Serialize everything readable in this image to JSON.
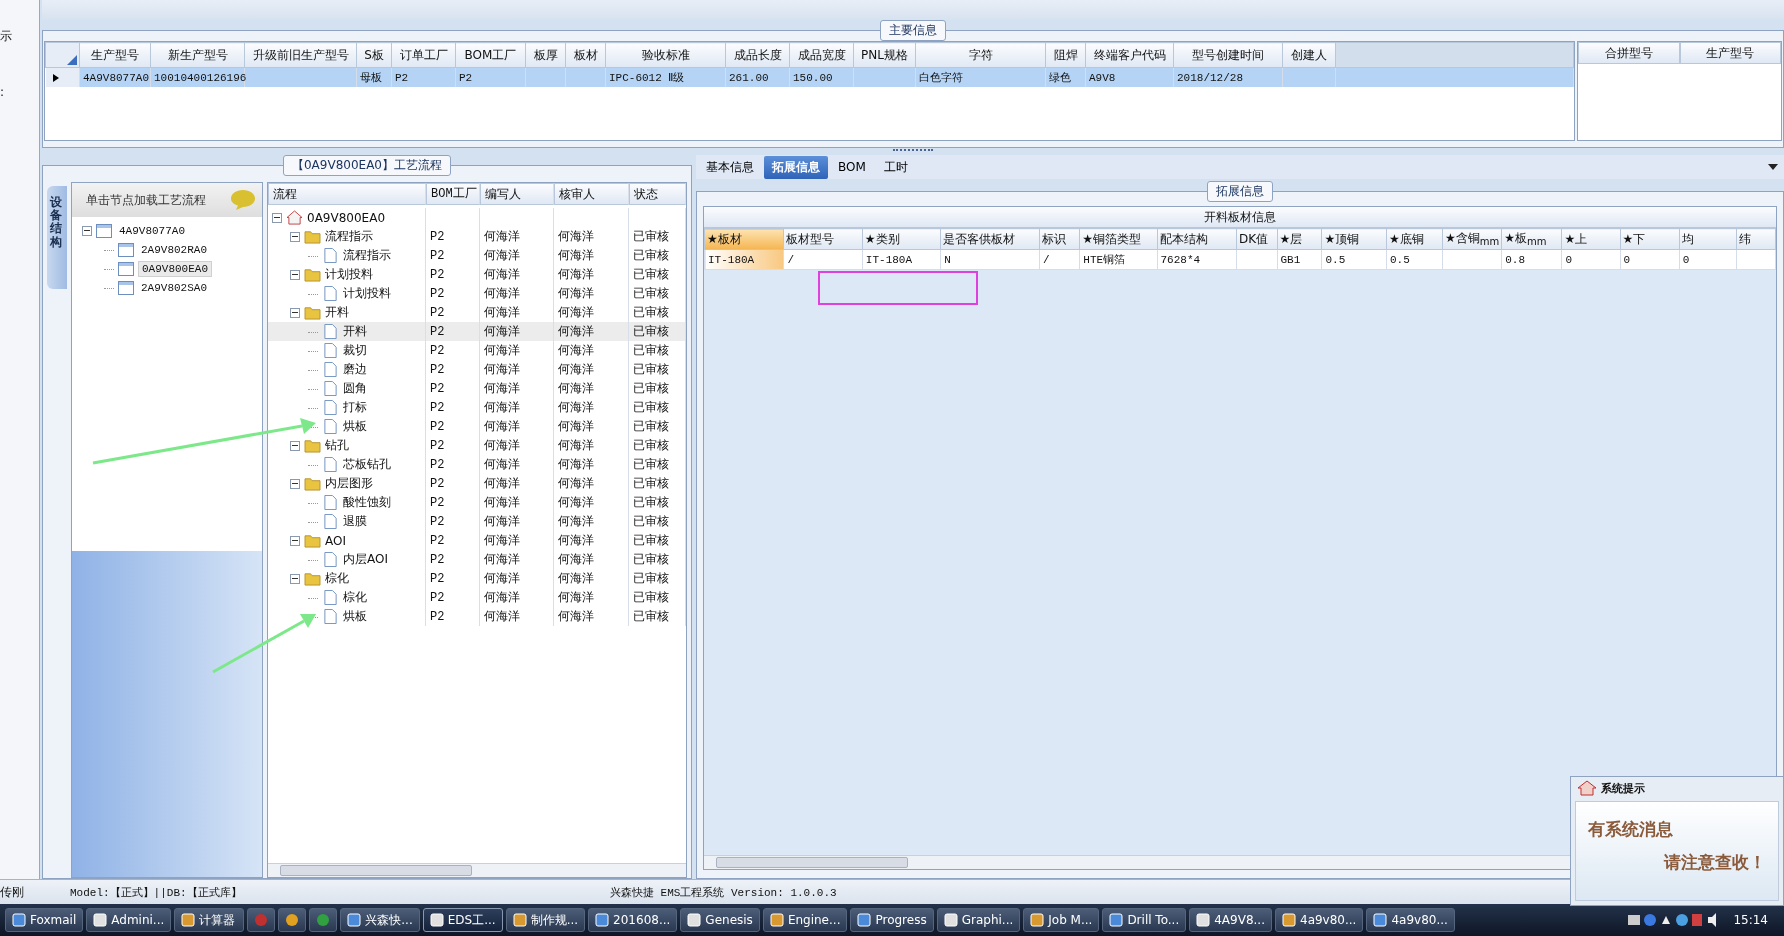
{
  "left_edge": {
    "texts": [
      "示",
      ":"
    ]
  },
  "main_info": {
    "title": "主要信息",
    "columns": [
      "生产型号",
      "新生产型号",
      "升级前旧生产型号",
      "S板",
      "订单工厂",
      "BOM工厂",
      "板厚",
      "板材",
      "验收标准",
      "成品长度",
      "成品宽度",
      "PNL规格",
      "字符",
      "阻焊",
      "终端客户代码",
      "型号创建时间",
      "创建人"
    ],
    "rows": [
      {
        "selected": true,
        "cells": [
          "4A9V8077A0",
          "10010400126196",
          null,
          "母板",
          "P2",
          "P2",
          null,
          null,
          "IPC-6012 Ⅱ级",
          "261.00",
          "150.00",
          null,
          "白色字符",
          "绿色",
          "A9V8",
          "2018/12/28",
          null
        ]
      }
    ],
    "side_columns": [
      "合拼型号",
      "生产型号"
    ]
  },
  "process": {
    "title": "【0A9V800EA0】工艺流程",
    "side_tab": "设备结构",
    "hint": "单击节点加载工艺流程",
    "model_tree": [
      {
        "label": "4A9V8077A0",
        "expanded": true,
        "selected": false,
        "children": [
          {
            "label": "2A9V802RA0",
            "selected": false
          },
          {
            "label": "0A9V800EA0",
            "selected": true
          },
          {
            "label": "2A9V802SA0",
            "selected": false
          }
        ]
      }
    ],
    "columns": [
      "流程",
      "BOM工厂",
      "编写人",
      "核审人",
      "状态"
    ],
    "tree": [
      {
        "label": "0A9V800EA0",
        "kind": "root",
        "expanded": true,
        "selected": false,
        "children": [
          {
            "label": "流程指示",
            "kind": "folder",
            "expanded": true,
            "selected": false,
            "bom": "P2",
            "writer": "何海洋",
            "reviewer": "何海洋",
            "status": "已审核",
            "children": [
              {
                "label": "流程指示",
                "kind": "step",
                "selected": false,
                "bom": "P2",
                "writer": "何海洋",
                "reviewer": "何海洋",
                "status": "已审核"
              }
            ]
          },
          {
            "label": "计划投料",
            "kind": "folder",
            "expanded": true,
            "selected": false,
            "bom": "P2",
            "writer": "何海洋",
            "reviewer": "何海洋",
            "status": "已审核",
            "children": [
              {
                "label": "计划投料",
                "kind": "step",
                "selected": false,
                "bom": "P2",
                "writer": "何海洋",
                "reviewer": "何海洋",
                "status": "已审核"
              }
            ]
          },
          {
            "label": "开料",
            "kind": "folder",
            "expanded": true,
            "selected": false,
            "bom": "P2",
            "writer": "何海洋",
            "reviewer": "何海洋",
            "status": "已审核",
            "children": [
              {
                "label": "开料",
                "kind": "step",
                "selected": true,
                "bom": "P2",
                "writer": "何海洋",
                "reviewer": "何海洋",
                "status": "已审核"
              },
              {
                "label": "裁切",
                "kind": "step",
                "selected": false,
                "bom": "P2",
                "writer": "何海洋",
                "reviewer": "何海洋",
                "status": "已审核"
              },
              {
                "label": "磨边",
                "kind": "step",
                "selected": false,
                "bom": "P2",
                "writer": "何海洋",
                "reviewer": "何海洋",
                "status": "已审核"
              },
              {
                "label": "圆角",
                "kind": "step",
                "selected": false,
                "bom": "P2",
                "writer": "何海洋",
                "reviewer": "何海洋",
                "status": "已审核"
              },
              {
                "label": "打标",
                "kind": "step",
                "selected": false,
                "bom": "P2",
                "writer": "何海洋",
                "reviewer": "何海洋",
                "status": "已审核"
              },
              {
                "label": "烘板",
                "kind": "step",
                "selected": false,
                "bom": "P2",
                "writer": "何海洋",
                "reviewer": "何海洋",
                "status": "已审核"
              }
            ]
          },
          {
            "label": "钻孔",
            "kind": "folder",
            "expanded": true,
            "selected": false,
            "bom": "P2",
            "writer": "何海洋",
            "reviewer": "何海洋",
            "status": "已审核",
            "children": [
              {
                "label": "芯板钻孔",
                "kind": "step",
                "selected": false,
                "bom": "P2",
                "writer": "何海洋",
                "reviewer": "何海洋",
                "status": "已审核"
              }
            ]
          },
          {
            "label": "内层图形",
            "kind": "folder",
            "expanded": true,
            "selected": false,
            "bom": "P2",
            "writer": "何海洋",
            "reviewer": "何海洋",
            "status": "已审核",
            "children": [
              {
                "label": "酸性蚀刻",
                "kind": "step",
                "selected": false,
                "bom": "P2",
                "writer": "何海洋",
                "reviewer": "何海洋",
                "status": "已审核"
              },
              {
                "label": "退膜",
                "kind": "step",
                "selected": false,
                "bom": "P2",
                "writer": "何海洋",
                "reviewer": "何海洋",
                "status": "已审核"
              }
            ]
          },
          {
            "label": "AOI",
            "kind": "folder",
            "expanded": true,
            "selected": false,
            "bom": "P2",
            "writer": "何海洋",
            "reviewer": "何海洋",
            "status": "已审核",
            "children": [
              {
                "label": "内层AOI",
                "kind": "step",
                "selected": false,
                "bom": "P2",
                "writer": "何海洋",
                "reviewer": "何海洋",
                "status": "已审核"
              }
            ]
          },
          {
            "label": "棕化",
            "kind": "folder",
            "expanded": true,
            "selected": false,
            "bom": "P2",
            "writer": "何海洋",
            "reviewer": "何海洋",
            "status": "已审核",
            "children": [
              {
                "label": "棕化",
                "kind": "step",
                "selected": false,
                "bom": "P2",
                "writer": "何海洋",
                "reviewer": "何海洋",
                "status": "已审核"
              },
              {
                "label": "烘板",
                "kind": "step",
                "selected": false,
                "bom": "P2",
                "writer": "何海洋",
                "reviewer": "何海洋",
                "status": "已审核"
              }
            ]
          }
        ]
      }
    ]
  },
  "detail": {
    "tabs": [
      {
        "label": "基本信息",
        "selected": false
      },
      {
        "label": "拓展信息",
        "selected": true
      },
      {
        "label": "BOM",
        "selected": false
      },
      {
        "label": "工时",
        "selected": false
      }
    ],
    "group_title": "拓展信息",
    "table_title": "开料板材信息",
    "columns": [
      {
        "label": "★板材",
        "selected": true
      },
      {
        "label": "板材型号",
        "selected": false
      },
      {
        "label": "★类别",
        "selected": false
      },
      {
        "label": "是否客供板材",
        "selected": false
      },
      {
        "label": "标识",
        "selected": false
      },
      {
        "label": "★铜箔类型",
        "selected": false
      },
      {
        "label": "配本结构",
        "selected": false
      },
      {
        "label": "DK值",
        "selected": false
      },
      {
        "label": "★层",
        "selected": false
      },
      {
        "label": "★顶铜",
        "selected": false
      },
      {
        "label": "★底铜",
        "selected": false
      },
      {
        "label": "★含铜$_{mm}$",
        "selected": false
      },
      {
        "label": "★板$_{mm}$",
        "selected": false
      },
      {
        "label": "★上",
        "selected": false
      },
      {
        "label": "★下",
        "selected": false
      },
      {
        "label": "均",
        "selected": false
      },
      {
        "label": "纬",
        "selected": false
      }
    ],
    "rows": [
      {
        "cells": [
          "IT-180A",
          "/",
          "IT-180A",
          "N",
          "/",
          "HTE铜箔",
          "7628*4",
          null,
          "GB1",
          "0.5",
          "0.5",
          null,
          "0.8",
          "0",
          "0",
          "0",
          null
        ]
      }
    ]
  },
  "status_bar": {
    "user": "传刚",
    "model": "Model:【正式】||DB:【正式库】",
    "app": "兴森快捷 EMS工程系统 Version: 1.0.0.3"
  },
  "popup": {
    "title": "系统提示",
    "lines": [
      "有系统消息",
      "请注意查收！"
    ]
  },
  "taskbar": {
    "items": [
      {
        "kind": "app",
        "label": "Foxmail",
        "selected": false
      },
      {
        "kind": "app",
        "label": "Admini...",
        "selected": false
      },
      {
        "kind": "app",
        "label": "计算器",
        "selected": false
      },
      {
        "kind": "icon",
        "selected": false
      },
      {
        "kind": "icon",
        "selected": false
      },
      {
        "kind": "icon",
        "selected": false
      },
      {
        "kind": "app",
        "label": "兴森快...",
        "selected": false
      },
      {
        "kind": "app",
        "label": "EDS工...",
        "selected": true
      },
      {
        "kind": "app",
        "label": "制作规...",
        "selected": false
      },
      {
        "kind": "app",
        "label": "201608...",
        "selected": false
      },
      {
        "kind": "app",
        "label": "Genesis",
        "selected": false
      },
      {
        "kind": "app",
        "label": "Engine...",
        "selected": false
      },
      {
        "kind": "app",
        "label": "Progress",
        "selected": false
      },
      {
        "kind": "app",
        "label": "Graphi...",
        "selected": false
      },
      {
        "kind": "app",
        "label": "Job M...",
        "selected": false
      },
      {
        "kind": "app",
        "label": "Drill To...",
        "selected": false
      },
      {
        "kind": "app",
        "label": "4A9V8...",
        "selected": false
      },
      {
        "kind": "app",
        "label": "4a9v80...",
        "selected": false
      },
      {
        "kind": "app",
        "label": "4a9v80...",
        "selected": false
      }
    ],
    "clock": "15:14"
  }
}
